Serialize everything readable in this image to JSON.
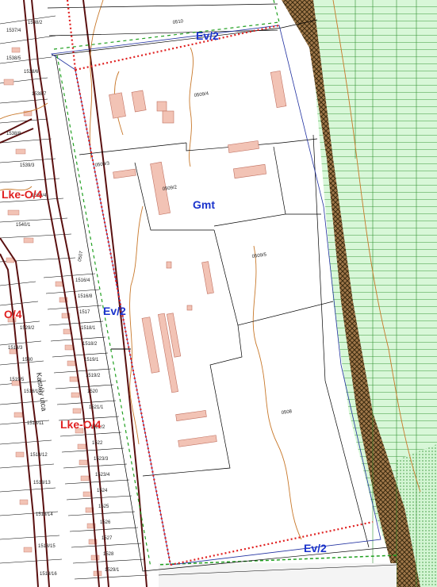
{
  "colors": {
    "forest_green": "#d3f5d3",
    "forest_hatch": "#8a5a2a",
    "building": "#f2c3b5",
    "building_stroke": "#c07060",
    "contour": "#c8782a",
    "parcel_line": "#000000",
    "road_line": "#5a1010",
    "boundary_red": "#e02020",
    "boundary_green": "#20a020",
    "boundary_blue": "#2030a0"
  },
  "zones": {
    "ev_top": "Ev/2",
    "ev_left": "Ev/2",
    "ev_bottom": "Ev/2",
    "gmt": "Gmt",
    "lke_upper": "Lke-O/4",
    "lke_left": "O/4",
    "lke_lower": "Lke-O/4"
  },
  "parcels": {
    "p0510": "0510",
    "p0509_4": "0509/4",
    "p0509_2": "0509/2",
    "p0509_3": "0509/3",
    "p0509_5": "0509/5",
    "p0508": "0508",
    "p0507": "0507"
  },
  "street": {
    "name": "Kastély utca"
  },
  "lot_labels": [
    "1537/4",
    "1538/2",
    "1538/5",
    "1538/6",
    "1538/7",
    "1538/8",
    "1539/3",
    "1539/4",
    "1540/1",
    "1516/4",
    "1516/8",
    "1517",
    "1518/1",
    "1518/2",
    "1519/1",
    "1519/2",
    "1520",
    "1521/1",
    "1521/2",
    "1522",
    "1523/3",
    "1523/4",
    "1524",
    "1525",
    "1526",
    "1527",
    "1528",
    "1529/1",
    "1529/2",
    "1530",
    "1518/10",
    "1518/11",
    "1518/12",
    "1518/13",
    "1518/14",
    "1518/15",
    "1518/16",
    "1519/3",
    "1519/5"
  ]
}
